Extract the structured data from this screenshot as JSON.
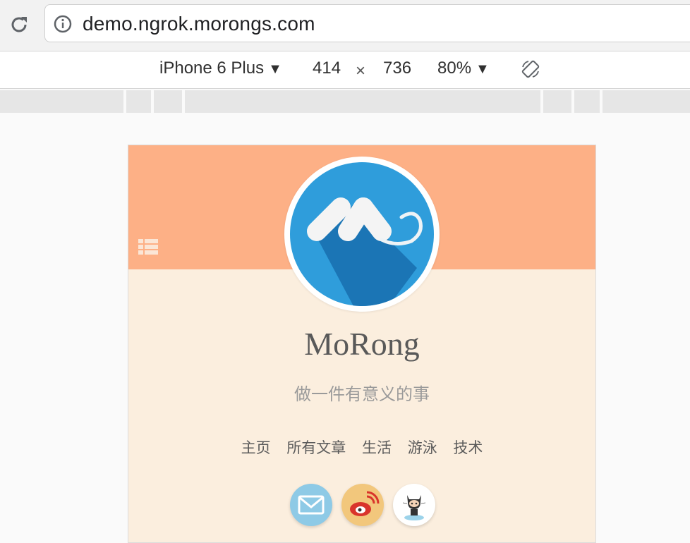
{
  "browser": {
    "url": "demo.ngrok.morongs.com"
  },
  "device_toolbar": {
    "device": "iPhone 6 Plus",
    "width": "414",
    "times": "×",
    "height": "736",
    "zoom": "80%"
  },
  "site": {
    "title": "MoRong",
    "subtitle": "做一件有意义的事",
    "nav": [
      "主页",
      "所有文章",
      "生活",
      "游泳",
      "技术"
    ],
    "social": [
      "mail-icon",
      "weibo-icon",
      "github-octocat-icon"
    ],
    "colors": {
      "banner": "#fdb086",
      "page": "#fbeede",
      "avatar_blue": "#2f9ddb"
    }
  }
}
